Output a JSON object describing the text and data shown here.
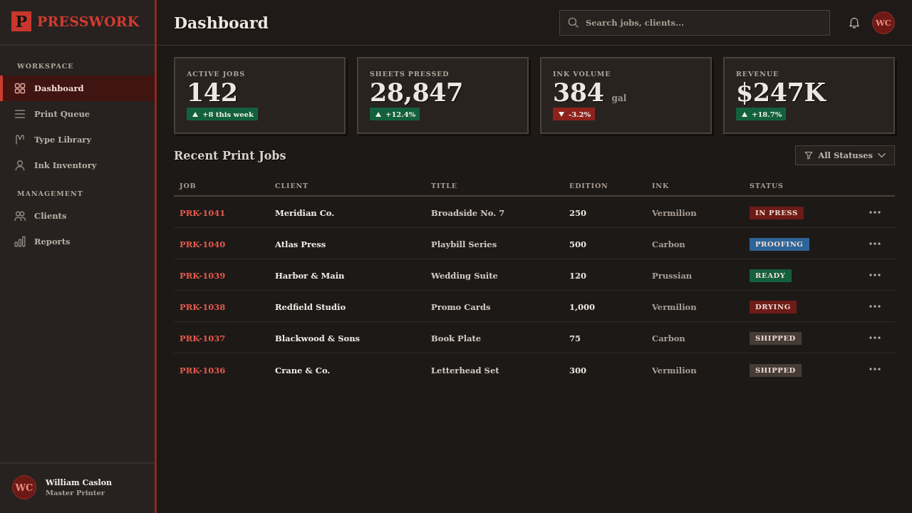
{
  "sidebar": {
    "logo": {
      "mark": "P",
      "name": "PRESSWORK"
    },
    "sections": [
      {
        "heading": "WORKSPACE",
        "items": [
          {
            "label": "Dashboard",
            "selected": true
          },
          {
            "label": "Print Queue",
            "selected": false
          },
          {
            "label": "Type Library",
            "selected": false
          },
          {
            "label": "Ink Inventory",
            "selected": false
          }
        ]
      },
      {
        "heading": "MANAGEMENT",
        "items": [
          {
            "label": "Clients",
            "selected": false
          },
          {
            "label": "Reports",
            "selected": false
          }
        ]
      }
    ],
    "user": {
      "initials": "WC",
      "name": "William Caslon",
      "role": "Master Printer"
    }
  },
  "header": {
    "title": "Dashboard",
    "search": {
      "placeholder": "Search jobs, clients..."
    },
    "avatar": {
      "initials": "WC"
    }
  },
  "stats": [
    {
      "label": "ACTIVE JOBS",
      "value": "142",
      "change": "+8 this week",
      "kind": "up"
    },
    {
      "label": "SHEETS PRESSED",
      "value": "28,847",
      "change": "+12.4%",
      "kind": "up"
    },
    {
      "label": "INK VOLUME",
      "value": "384",
      "unit": "gal",
      "change": "-3.2%",
      "kind": "down"
    },
    {
      "label": "REVENUE",
      "value": "$247K",
      "change": "+18.7%",
      "kind": "up"
    }
  ],
  "jobs": {
    "title": "Recent Print Jobs",
    "filter": {
      "label": "All Statuses"
    },
    "columns": [
      "JOB",
      "CLIENT",
      "TITLE",
      "EDITION",
      "INK",
      "STATUS"
    ],
    "rows": [
      {
        "job": "PRK-1041",
        "client": "Meridian Co.",
        "title": "Broadside No. 7",
        "edition": "250",
        "ink": "Vermilion",
        "status": {
          "label": "IN PRESS",
          "color": "#6c1b17"
        }
      },
      {
        "job": "PRK-1040",
        "client": "Atlas Press",
        "title": "Playbill Series",
        "edition": "500",
        "ink": "Carbon",
        "status": {
          "label": "PROOFING",
          "color": "#2e6497"
        }
      },
      {
        "job": "PRK-1039",
        "client": "Harbor & Main",
        "title": "Wedding Suite",
        "edition": "120",
        "ink": "Prussian",
        "status": {
          "label": "READY",
          "color": "#14603e"
        }
      },
      {
        "job": "PRK-1038",
        "client": "Redfield Studio",
        "title": "Promo Cards",
        "edition": "1,000",
        "ink": "Vermilion",
        "status": {
          "label": "DRYING",
          "color": "#6e1c18"
        }
      },
      {
        "job": "PRK-1037",
        "client": "Blackwood & Sons",
        "title": "Book Plate",
        "edition": "75",
        "ink": "Carbon",
        "status": {
          "label": "SHIPPED",
          "color": "#463c36"
        }
      },
      {
        "job": "PRK-1036",
        "client": "Crane & Co.",
        "title": "Letterhead Set",
        "edition": "300",
        "ink": "Vermilion",
        "status": {
          "label": "SHIPPED",
          "color": "#463c36"
        }
      }
    ]
  }
}
